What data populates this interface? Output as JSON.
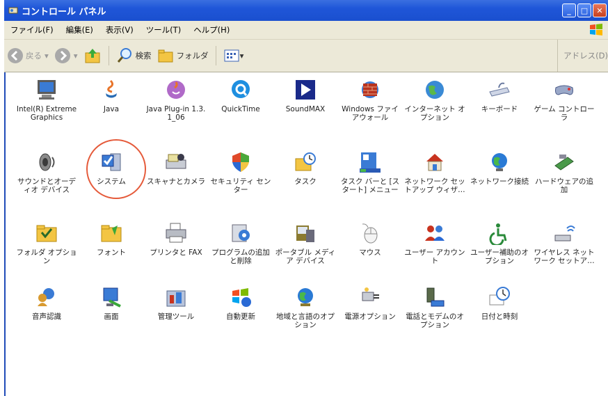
{
  "window": {
    "title": "コントロール パネル"
  },
  "menubar": {
    "items": [
      "ファイル(F)",
      "編集(E)",
      "表示(V)",
      "ツール(T)",
      "ヘルプ(H)"
    ]
  },
  "toolbar": {
    "back": "戻る",
    "search": "検索",
    "folders": "フォルダ",
    "address": "アドレス(D)"
  },
  "items": [
    {
      "label": "Intel(R) Extreme Graphics",
      "icon": "monitor-icon"
    },
    {
      "label": "Java",
      "icon": "java-icon"
    },
    {
      "label": "Java Plug-in 1.3.1_06",
      "icon": "java-plugin-icon"
    },
    {
      "label": "QuickTime",
      "icon": "quicktime-icon"
    },
    {
      "label": "SoundMAX",
      "icon": "soundmax-icon"
    },
    {
      "label": "Windows ファイアウォール",
      "icon": "firewall-icon"
    },
    {
      "label": "インターネット オプション",
      "icon": "internet-globe-icon"
    },
    {
      "label": "キーボード",
      "icon": "keyboard-icon"
    },
    {
      "label": "ゲーム コントローラ",
      "icon": "game-controller-icon"
    },
    {
      "label": "サウンドとオーディオ デバイス",
      "icon": "speaker-icon"
    },
    {
      "label": "システム",
      "icon": "system-icon"
    },
    {
      "label": "スキャナとカメラ",
      "icon": "scanner-icon"
    },
    {
      "label": "セキュリティ センター",
      "icon": "shield-icon"
    },
    {
      "label": "タスク",
      "icon": "scheduled-tasks-icon"
    },
    {
      "label": "タスク バーと [スタート] メニュー",
      "icon": "taskbar-icon"
    },
    {
      "label": "ネットワーク セットアップ ウィザ…",
      "icon": "network-home-icon"
    },
    {
      "label": "ネットワーク接続",
      "icon": "network-globe-icon"
    },
    {
      "label": "ハードウェアの追加",
      "icon": "hardware-icon"
    },
    {
      "label": "フォルダ オプション",
      "icon": "folder-options-icon"
    },
    {
      "label": "フォント",
      "icon": "fonts-folder-icon"
    },
    {
      "label": "プリンタと FAX",
      "icon": "printer-icon"
    },
    {
      "label": "プログラムの追加と削除",
      "icon": "add-remove-icon"
    },
    {
      "label": "ポータブル メディア デバイス",
      "icon": "portable-media-icon"
    },
    {
      "label": "マウス",
      "icon": "mouse-icon"
    },
    {
      "label": "ユーザー アカウント",
      "icon": "users-icon"
    },
    {
      "label": "ユーザー補助のオプション",
      "icon": "accessibility-icon"
    },
    {
      "label": "ワイヤレス ネットワーク セットア…",
      "icon": "wireless-icon"
    },
    {
      "label": "音声認識",
      "icon": "speech-icon"
    },
    {
      "label": "画面",
      "icon": "display-icon"
    },
    {
      "label": "管理ツール",
      "icon": "admin-tools-icon"
    },
    {
      "label": "自動更新",
      "icon": "windows-update-icon"
    },
    {
      "label": "地域と言語のオプション",
      "icon": "regional-globe-icon"
    },
    {
      "label": "電源オプション",
      "icon": "power-icon"
    },
    {
      "label": "電話とモデムのオプション",
      "icon": "phone-modem-icon"
    },
    {
      "label": "日付と時刻",
      "icon": "clock-icon"
    }
  ]
}
